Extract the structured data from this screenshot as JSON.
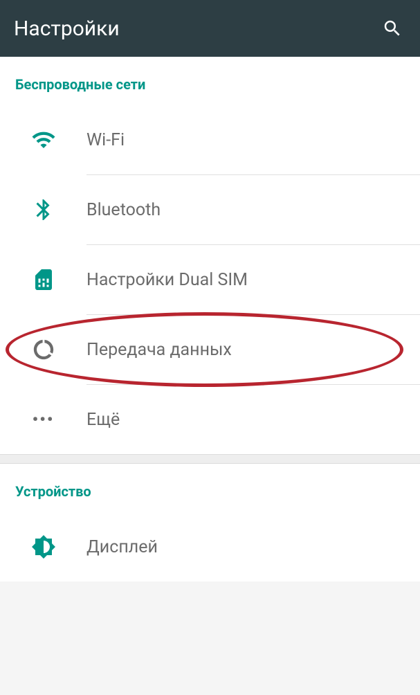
{
  "header": {
    "title": "Настройки"
  },
  "sections": [
    {
      "header": "Беспроводные сети",
      "items": [
        {
          "label": "Wi-Fi",
          "icon": "wifi"
        },
        {
          "label": "Bluetooth",
          "icon": "bluetooth"
        },
        {
          "label": "Настройки Dual SIM",
          "icon": "sim"
        },
        {
          "label": "Передача данных",
          "icon": "data-usage",
          "highlighted": true
        },
        {
          "label": "Ещё",
          "icon": "more"
        }
      ]
    },
    {
      "header": "Устройство",
      "items": [
        {
          "label": "Дисплей",
          "icon": "display"
        }
      ]
    }
  ],
  "colors": {
    "accent": "#009688",
    "header_bg": "#2d3e44",
    "text_secondary": "#6b6b6b",
    "highlight": "#b8252f"
  }
}
